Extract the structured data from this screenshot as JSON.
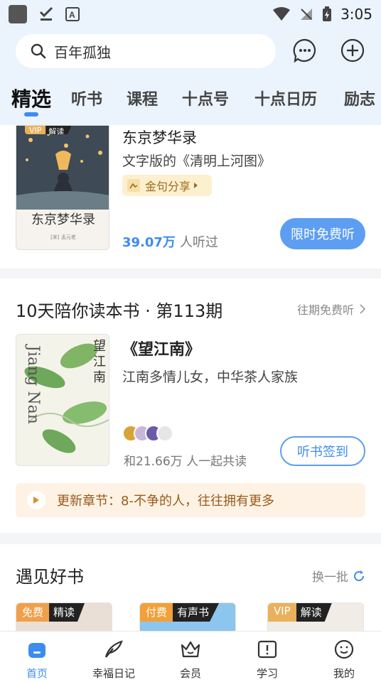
{
  "status_bar": {
    "time": "3:05"
  },
  "search": {
    "placeholder": "百年孤独"
  },
  "tabs": [
    {
      "label": "精选",
      "active": true
    },
    {
      "label": "听书"
    },
    {
      "label": "课程"
    },
    {
      "label": "十点号"
    },
    {
      "label": "十点日历"
    },
    {
      "label": "励志"
    }
  ],
  "featured": {
    "badge_vip": "VIP",
    "badge_type": "解读",
    "cover_title": "东京梦华录",
    "cover_author": "[宋] 孟元老",
    "title": "东京梦华录",
    "subtitle": "文字版的《清明上河图》",
    "chip": "金句分享",
    "listen_count": "39.07万",
    "listen_label": "人听过",
    "button": "限时免费听"
  },
  "reading_plan": {
    "title": "10天陪你读本书 · 第113期",
    "more": "往期免费听",
    "book_title": "《望江南》",
    "book_desc": "江南多情儿女，中华茶人家族",
    "cover_text_cn": "望江南",
    "cover_text_en": "Jiang Nan",
    "readers": "和21.66万 人一起共读",
    "button": "听书签到",
    "update": "更新章节：8-不争的人，往往拥有更多"
  },
  "good_books": {
    "title": "遇见好书",
    "refresh": "换一批",
    "items": [
      {
        "tag": "免费",
        "type": "精读",
        "tag_color": "#f0a04b"
      },
      {
        "tag": "付费",
        "type": "有声书",
        "tag_color": "#f2a03a"
      },
      {
        "tag": "VIP",
        "type": "解读",
        "tag_color": "#e9b15c"
      }
    ]
  },
  "bottom_nav": [
    {
      "label": "首页",
      "icon": "home-icon",
      "active": true
    },
    {
      "label": "幸福日记",
      "icon": "feather-icon"
    },
    {
      "label": "会员",
      "icon": "crown-icon"
    },
    {
      "label": "学习",
      "icon": "book-icon"
    },
    {
      "label": "我的",
      "icon": "profile-icon"
    }
  ],
  "colors": {
    "accent": "#3d8cf0",
    "header_bg": "#ebf3fd"
  }
}
